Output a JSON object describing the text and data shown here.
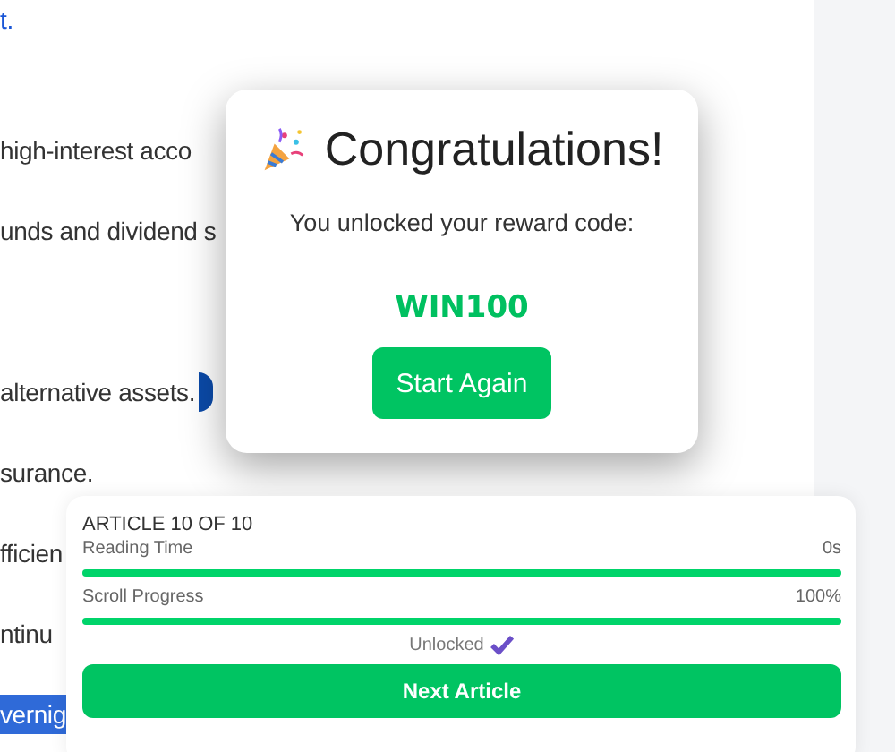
{
  "article": {
    "lines": [
      {
        "text": "t.",
        "kind": "link"
      },
      {
        "text": "high-interest acco",
        "kind": "plain"
      },
      {
        "text": "unds and dividend s",
        "kind": "plain"
      },
      {
        "text": "alternative assets.",
        "kind": "marked"
      },
      {
        "text": "surance.",
        "kind": "plain"
      },
      {
        "text": "fficien",
        "kind": "plain"
      },
      {
        "text": "ntinu",
        "kind": "plain"
      },
      {
        "text": "vernig",
        "kind": "selected"
      }
    ]
  },
  "modal": {
    "title": "Congratulations!",
    "message": "You unlocked your reward code:",
    "code": "WIN100",
    "button": "Start Again"
  },
  "progress_panel": {
    "heading": "ARTICLE 10 OF 10",
    "meters": [
      {
        "label": "Reading Time",
        "reading": "0s",
        "level": 1
      },
      {
        "label": "Scroll Progress",
        "reading": "100%",
        "level": 1
      }
    ],
    "status": "Unlocked",
    "unlocked": true,
    "button": "Next Article"
  }
}
